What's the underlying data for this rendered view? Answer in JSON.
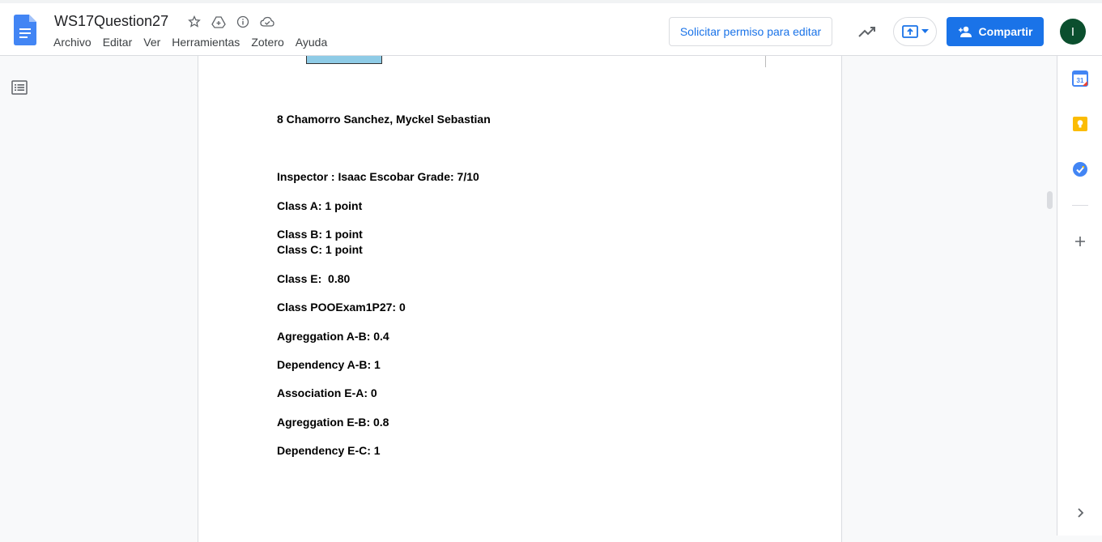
{
  "header": {
    "title": "WS17Question27",
    "menu": [
      "Archivo",
      "Editar",
      "Ver",
      "Herramientas",
      "Zotero",
      "Ayuda"
    ],
    "permission_label": "Solicitar permiso para editar",
    "share_label": "Compartir",
    "avatar_letter": "I"
  },
  "document": {
    "lines": [
      "8 Chamorro Sanchez, Myckel Sebastian",
      "Inspector : Isaac Escobar Grade: 7/10",
      "Class A: 1 point",
      "Class B: 1 point",
      "Class C: 1 point",
      "Class E:  0.80",
      "Class POOExam1P27: 0",
      "Agreggation A-B: 0.4",
      "Dependency A-B: 1",
      "Association E-A: 0",
      "Agreggation E-B: 0.8",
      "Dependency E-C: 1"
    ]
  },
  "right_panel": {
    "calendar_day": "31"
  },
  "colors": {
    "brand_blue": "#1a73e8",
    "avatar_green": "#0b4f2e"
  }
}
